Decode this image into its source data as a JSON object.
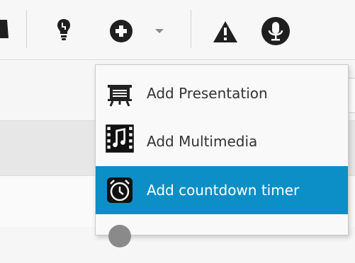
{
  "toolbar": {
    "icons": [
      "cart-icon",
      "lightbulb-icon",
      "add-circle-icon",
      "dropdown-arrow-icon",
      "warning-icon",
      "microphone-icon"
    ]
  },
  "menu": {
    "items": [
      {
        "label": "Add Presentation",
        "icon": "presentation-easel-icon",
        "active": false
      },
      {
        "label": "Add Multimedia",
        "icon": "film-music-icon",
        "active": false
      },
      {
        "label": "Add countdown timer",
        "icon": "alarm-clock-icon",
        "active": true
      }
    ]
  },
  "colors": {
    "menu_highlight": "#0b8fc6",
    "icon_dark": "#222222"
  }
}
